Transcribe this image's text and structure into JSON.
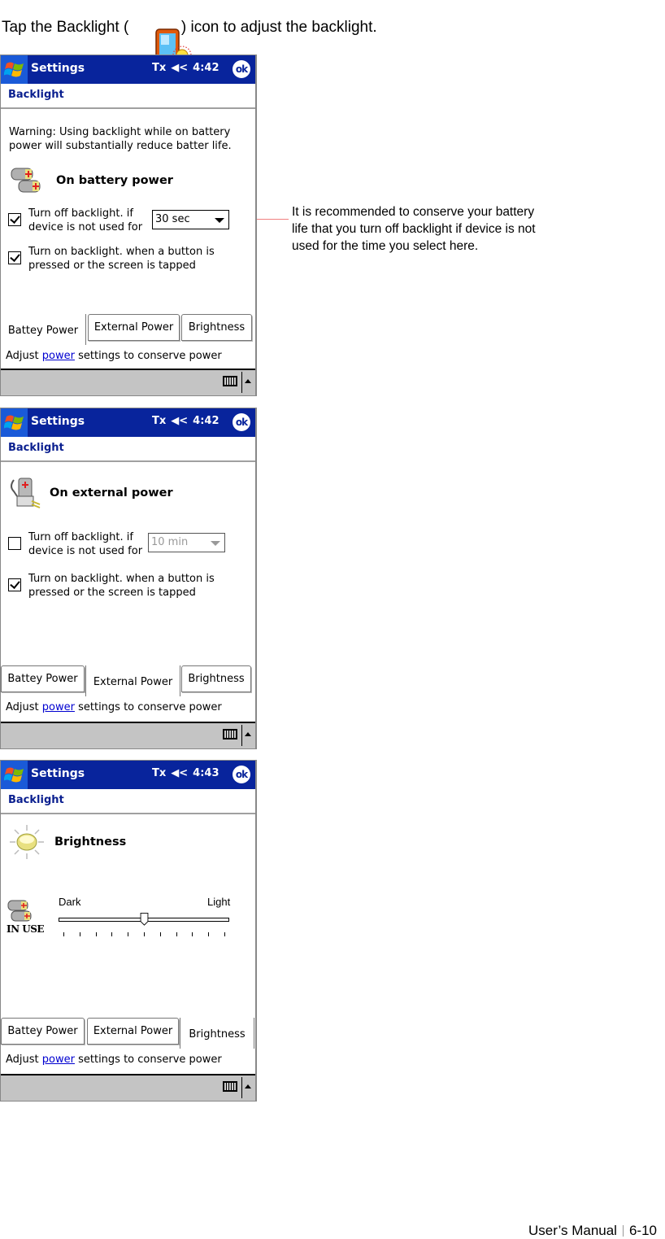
{
  "intro": {
    "before": "Tap the Backlight ( ",
    "after": " ) icon to adjust the backlight.",
    "icon": "backlight-icon"
  },
  "screens": [
    {
      "titlebar": {
        "title": "Settings",
        "antenna": "Tx",
        "time": "4:42",
        "ok": "ok"
      },
      "subhead": "Backlight",
      "warning": [
        "Warning: Using backlight while on battery",
        "power will substantially reduce batter life."
      ],
      "section": {
        "label": "On battery power",
        "icon": "battery-icon"
      },
      "turn_off": {
        "line1": "Turn off backlight. if",
        "line2": "device is not used for",
        "checked": true,
        "select_value": "30 sec",
        "enabled": true
      },
      "turn_on": {
        "line1": "Turn on backlight. when a button is",
        "line2": "pressed or the screen is tapped",
        "checked": true
      },
      "tabs": [
        "Battey Power",
        "External Power",
        "Brightness"
      ],
      "active_tab": 0,
      "footer": {
        "prefix": "Adjust ",
        "link": "power",
        "suffix": " settings to conserve power"
      }
    },
    {
      "titlebar": {
        "title": "Settings",
        "antenna": "Tx",
        "time": "4:42",
        "ok": "ok"
      },
      "subhead": "Backlight",
      "section": {
        "label": "On external power",
        "icon": "external-power-icon"
      },
      "turn_off": {
        "line1": "Turn off backlight. if",
        "line2": "device is not used for",
        "checked": false,
        "select_value": "10 min",
        "enabled": false
      },
      "turn_on": {
        "line1": "Turn on backlight. when a button is",
        "line2": "pressed or the screen is tapped",
        "checked": true
      },
      "tabs": [
        "Battey Power",
        "External Power",
        "Brightness"
      ],
      "active_tab": 1,
      "footer": {
        "prefix": "Adjust ",
        "link": "power",
        "suffix": " settings to conserve power"
      }
    },
    {
      "titlebar": {
        "title": "Settings",
        "antenna": "Tx",
        "time": "4:43",
        "ok": "ok"
      },
      "subhead": "Backlight",
      "section": {
        "label": "Brightness",
        "icon": "brightness-bulb-icon"
      },
      "slider": {
        "min_label": "Dark",
        "max_label": "Light",
        "value_fraction": 0.5,
        "tick_count": 11,
        "badge": "IN USE"
      },
      "tabs": [
        "Battey Power",
        "External Power",
        "Brightness"
      ],
      "active_tab": 2,
      "footer": {
        "prefix": "Adjust ",
        "link": "power",
        "suffix": " settings to conserve power"
      }
    }
  ],
  "callout": "It is recommended to conserve your battery life that you turn off backlight if device is not used for the time you select here.",
  "page_footer": {
    "manual": "User’s Manual",
    "page": "6-10"
  },
  "colors": {
    "titlebar": "#08249c",
    "link": "#0000d0",
    "callout_dot": "#e00000"
  }
}
